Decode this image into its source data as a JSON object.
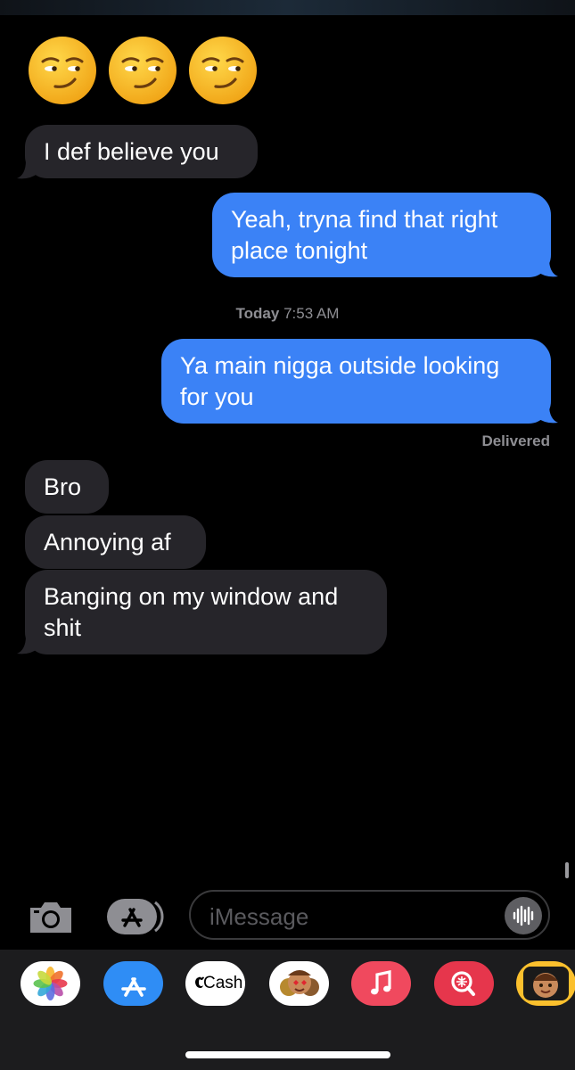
{
  "emojis": [
    "smirking-face",
    "smirking-face",
    "smirking-face"
  ],
  "messages": [
    {
      "id": "m1",
      "dir": "in",
      "text": "I def believe you"
    },
    {
      "id": "m2",
      "dir": "out",
      "lines": [
        "Yeah, tryna find that right",
        "place tonight"
      ]
    },
    {
      "id": "m3",
      "dir": "out",
      "lines": [
        "Ya main nigga outside looking",
        "for you"
      ]
    },
    {
      "id": "m4",
      "dir": "in",
      "text": "Bro"
    },
    {
      "id": "m5",
      "dir": "in",
      "text": "Annoying af"
    },
    {
      "id": "m6",
      "dir": "in",
      "lines": [
        "Banging on my window and",
        "shit"
      ]
    }
  ],
  "timestamp": {
    "day": "Today",
    "time": "7:53 AM"
  },
  "delivered_label": "Delivered",
  "compose": {
    "placeholder": "iMessage"
  },
  "app_tray": [
    {
      "name": "photos-app-icon"
    },
    {
      "name": "app-store-icon"
    },
    {
      "name": "apple-cash-icon",
      "label": "Cash"
    },
    {
      "name": "memoji-stickers-icon"
    },
    {
      "name": "music-app-icon"
    },
    {
      "name": "image-search-icon"
    },
    {
      "name": "memoji-icon"
    }
  ],
  "colors": {
    "outgoing": "#3b82f6",
    "incoming": "#26252a",
    "background": "#000000",
    "tray": "#1c1c1e"
  }
}
